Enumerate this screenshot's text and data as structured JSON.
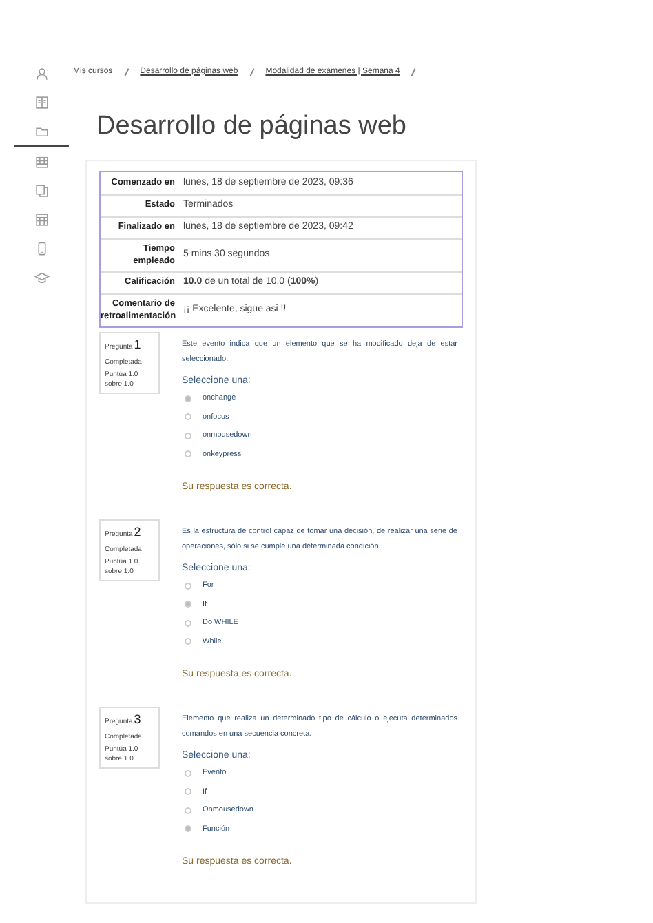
{
  "sidebar": {
    "items": [
      {
        "kind": "person",
        "selected": false
      },
      {
        "kind": "book",
        "selected": false
      },
      {
        "kind": "folder",
        "selected": true
      },
      {
        "kind": "calendar",
        "selected": false
      },
      {
        "kind": "copy",
        "selected": false
      },
      {
        "kind": "grid",
        "selected": false
      },
      {
        "kind": "phone",
        "selected": false
      },
      {
        "kind": "cap",
        "selected": false
      }
    ]
  },
  "breadcrumb": [
    {
      "label": "Mis cursos",
      "link": false
    },
    {
      "label": "Desarrollo de páginas web",
      "link": true
    },
    {
      "label": "Modalidad de exámenes | Semana 4",
      "link": true
    }
  ],
  "title": "Desarrollo de páginas web",
  "summary": [
    {
      "label": "Comenzado en",
      "value": "lunes, 18 de septiembre de 2023, 09:36"
    },
    {
      "label": "Estado",
      "value": "Terminados"
    },
    {
      "label": "Finalizado en",
      "value": "lunes, 18 de septiembre de 2023, 09:42"
    },
    {
      "label": "Tiempo empleado",
      "value": "5 mins 30 segundos"
    },
    {
      "label": "Calificación",
      "value": "**10.0** de un total de 10.0 (**100%**)"
    },
    {
      "label": "Comentario de retroalimentación",
      "value": "¡¡ Excelente, sigue asi !!"
    }
  ],
  "questions": [
    {
      "label": "Pregunta",
      "number": "1",
      "status": "Completada",
      "score": "Puntúa 1.0 sobre 1.0",
      "text": "Este evento indica que un elemento que se ha modificado deja de estar seleccionado.",
      "prompt": "Seleccione una:",
      "options": [
        {
          "label": "onchange",
          "selected": true
        },
        {
          "label": "onfocus",
          "selected": false
        },
        {
          "label": "onmousedown",
          "selected": false
        },
        {
          "label": "onkeypress",
          "selected": false
        }
      ],
      "feedback": "Su respuesta es correcta."
    },
    {
      "label": "Pregunta",
      "number": "2",
      "status": "Completada",
      "score": "Puntúa 1.0 sobre 1.0",
      "text": "Es la estructura de control capaz de tomar una decisión, de realizar una serie de operaciones, sólo si se cumple una determinada condición.",
      "prompt": "Seleccione una:",
      "options": [
        {
          "label": "For",
          "selected": false
        },
        {
          "label": "If",
          "selected": true
        },
        {
          "label": "Do WHILE",
          "selected": false
        },
        {
          "label": "While",
          "selected": false
        }
      ],
      "feedback": "Su respuesta es correcta."
    },
    {
      "label": "Pregunta",
      "number": "3",
      "status": "Completada",
      "score": "Puntúa 1.0 sobre 1.0",
      "text": "Elemento que realiza un determinado tipo de cálculo o ejecuta determinados comandos en una secuencia concreta.",
      "prompt": "Seleccione una:",
      "options": [
        {
          "label": "Evento",
          "selected": false
        },
        {
          "label": "If",
          "selected": false
        },
        {
          "label": "Onmousedown",
          "selected": false
        },
        {
          "label": "Función",
          "selected": true
        }
      ],
      "feedback": "Su respuesta es correcta."
    }
  ]
}
